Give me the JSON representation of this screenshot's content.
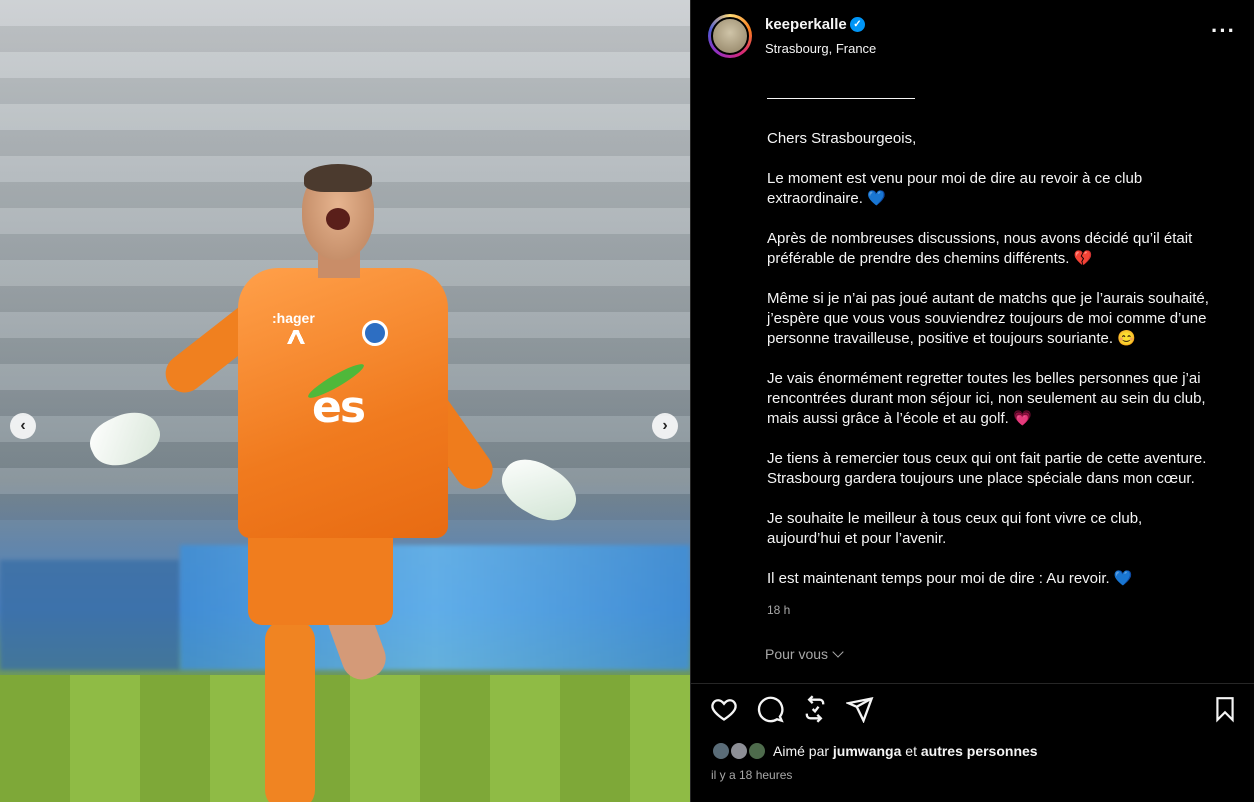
{
  "post": {
    "username": "keeperkalle",
    "location": "Strasbourg, France",
    "verified_icon": "verified-badge-icon",
    "caption": [
      "Chers Strasbourgeois,",
      "Le moment est venu pour moi de dire au revoir à ce club\nextraordinaire. 💙",
      "Après de nombreuses discussions, nous avons décidé qu’il était\npréférable de prendre des chemins différents. 💔",
      "Même si je n’ai pas joué autant de matchs que je l’aurais souhaité,\nj’espère que vous vous souviendrez toujours de moi comme d’une\npersonne travailleuse, positive et toujours souriante. 😊",
      "Je vais énormément regretter toutes les belles personnes que j’ai\nrencontrées durant mon séjour ici, non seulement au sein du club,\nmais aussi grâce à l’école et au golf. 💗",
      "Je tiens à remercier tous ceux qui ont fait partie de cette aventure.\nStrasbourg gardera toujours une place spéciale dans mon cœur.",
      "Je souhaite le meilleur à tous ceux qui font vivre ce club,\naujourd’hui et pour l’avenir.",
      "Il est maintenant temps pour moi de dire : Au revoir. 💙"
    ],
    "caption_time": "18 h",
    "for_you_label": "Pour vous",
    "liked_by_prefix": "Aimé par",
    "liked_by_user": "jumwanga",
    "liked_by_and": "et",
    "liked_by_others": "autres personnes",
    "posted_time": "il y a 18 heures"
  },
  "photo": {
    "jersey_sponsor": ":hager",
    "jersey_logo": "es",
    "nav_prev": "‹",
    "nav_next": "›"
  },
  "colors": {
    "background": "#000000",
    "text": "#f5f5f5",
    "muted": "#a8a8a8",
    "verified": "#0095f6"
  }
}
